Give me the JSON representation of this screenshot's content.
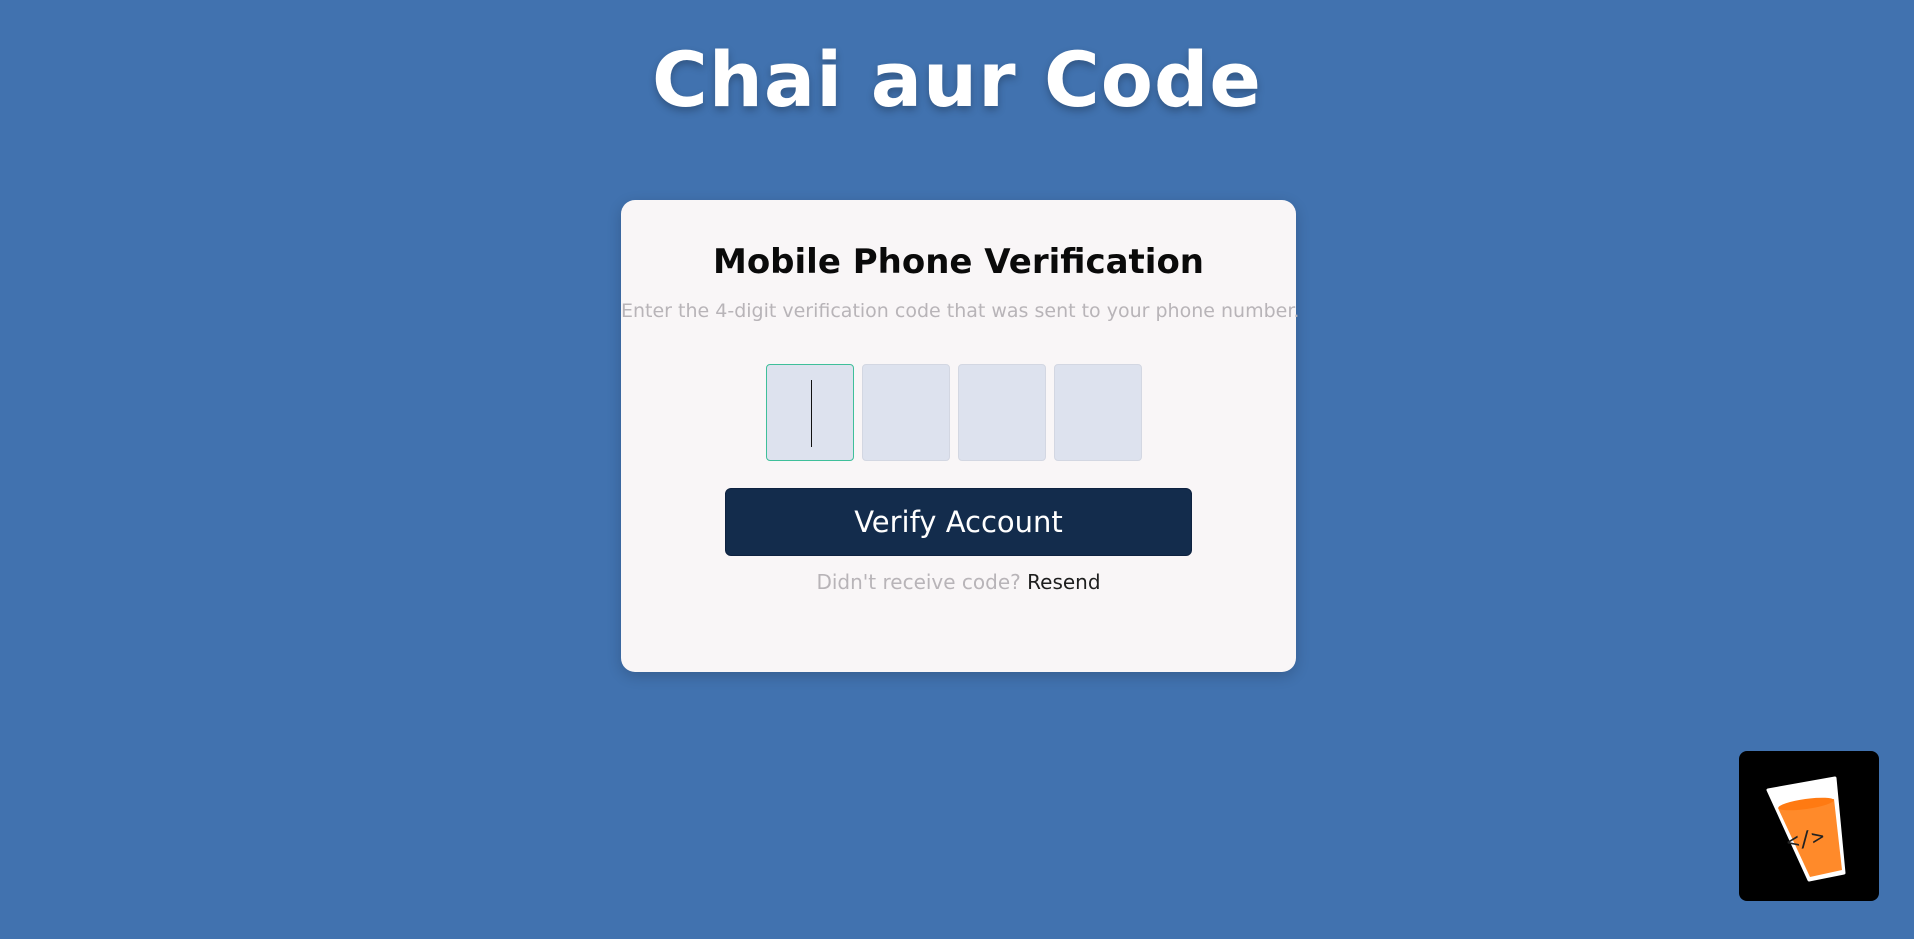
{
  "header": {
    "title": "Chai aur Code"
  },
  "card": {
    "title": "Mobile Phone Verification",
    "subtitle": "Enter the 4-digit verification code that was sent to your phone number.",
    "code_inputs": [
      {
        "value": ""
      },
      {
        "value": ""
      },
      {
        "value": ""
      },
      {
        "value": ""
      }
    ],
    "verify_label": "Verify Account",
    "resend_prompt": "Didn't receive code?",
    "resend_label": "Resend"
  },
  "logo": {
    "icon": "chai-cup-code-icon",
    "cup_text": "</>"
  },
  "colors": {
    "background": "#4172af",
    "card": "#f9f6f7",
    "button": "#132c4c",
    "input_bg": "#dde2ee",
    "focus_border": "#3fbf9a",
    "cup_orange": "#ff8a2a"
  }
}
